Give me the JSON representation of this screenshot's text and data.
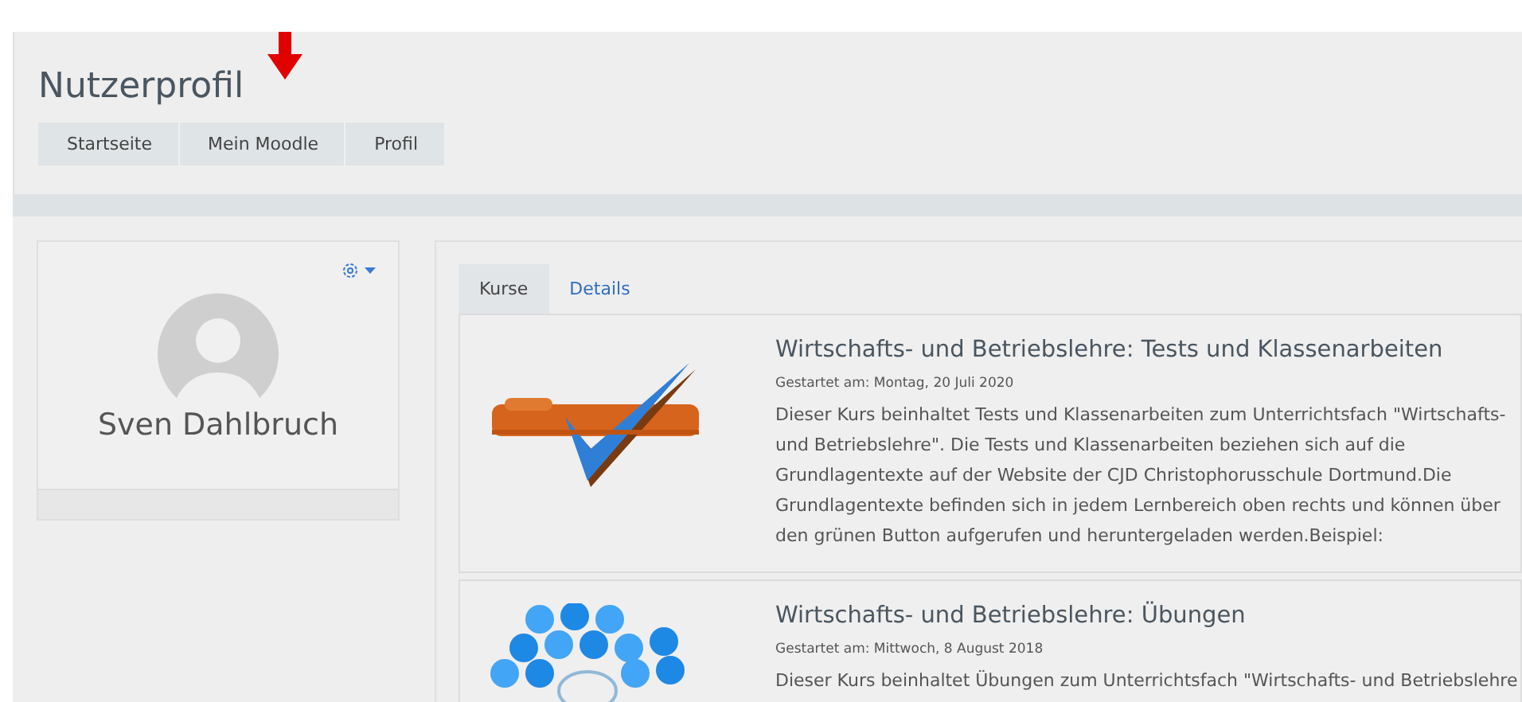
{
  "page": {
    "title": "Nutzerprofil"
  },
  "breadcrumb": [
    {
      "label": "Startseite"
    },
    {
      "label": "Mein Moodle"
    },
    {
      "label": "Profil"
    }
  ],
  "annotation": {
    "kind": "arrow",
    "color": "#e00000"
  },
  "profile": {
    "name": "Sven Dahlbruch"
  },
  "tabs": [
    {
      "label": "Kurse",
      "selected": true
    },
    {
      "label": "Details",
      "selected": false
    }
  ],
  "courses": [
    {
      "title": "Wirtschafts- und Betriebslehre: Tests und Klassenarbeiten",
      "started": "Gestartet am: Montag, 20 Juli 2020",
      "description": "Dieser Kurs beinhaltet Tests und Klassenarbeiten  zum Unterrichtsfach \"Wirtschafts- und Betriebslehre\". Die Tests und Klassenarbeiten beziehen sich auf die Grundlagentexte auf der Website der CJD Christophorusschule Dortmund.Die Grundlagentexte befinden sich in jedem Lernbereich oben rechts und können über den grünen Button aufgerufen und heruntergeladen werden.Beispiel:"
    },
    {
      "title": "Wirtschafts- und Betriebslehre: Übungen",
      "started": "Gestartet am: Mittwoch, 8 August 2018",
      "description": "Dieser Kurs beinhaltet Übungen zum Unterrichtsfach \"Wirtschafts- und Betriebslehre"
    }
  ]
}
